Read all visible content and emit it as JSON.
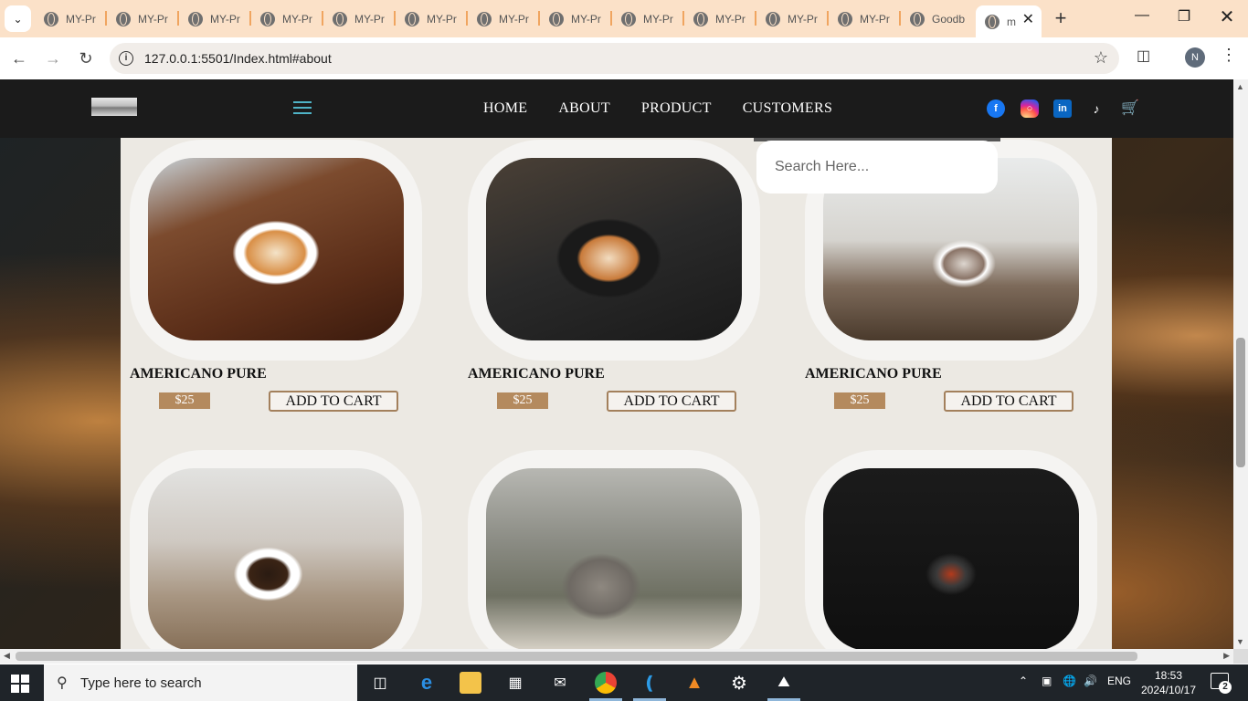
{
  "browser": {
    "tabs": [
      {
        "label": "MY-Pr"
      },
      {
        "label": "MY-Pr"
      },
      {
        "label": "MY-Pr"
      },
      {
        "label": "MY-Pr"
      },
      {
        "label": "MY-Pr"
      },
      {
        "label": "MY-Pr"
      },
      {
        "label": "MY-Pr"
      },
      {
        "label": "MY-Pr"
      },
      {
        "label": "MY-Pr"
      },
      {
        "label": "MY-Pr"
      },
      {
        "label": "MY-Pr"
      },
      {
        "label": "MY-Pr"
      },
      {
        "label": "Goodb"
      }
    ],
    "active_tab": {
      "label": "m"
    },
    "url": "127.0.0.1:5501/Index.html#about",
    "profile_initial": "N"
  },
  "site": {
    "nav": [
      "HOME",
      "ABOUT",
      "PRODUCT",
      "CUSTOMERS"
    ],
    "search_placeholder": "Search Here...",
    "products": [
      {
        "name": "AMERICANO PURE",
        "price": "$25",
        "button": "ADD TO CART"
      },
      {
        "name": "AMERICANO PURE",
        "price": "$25",
        "button": "ADD TO CART"
      },
      {
        "name": "AMERICANO PURE",
        "price": "$25",
        "button": "ADD TO CART"
      }
    ],
    "colors": {
      "header": "#1b1b1b",
      "price_bg": "#b48a5e",
      "panel": "#ece9e3"
    }
  },
  "taskbar": {
    "search_text": "Type here to search",
    "language": "ENG",
    "time": "18:53",
    "date": "2024/10/17",
    "notifications": "2"
  }
}
